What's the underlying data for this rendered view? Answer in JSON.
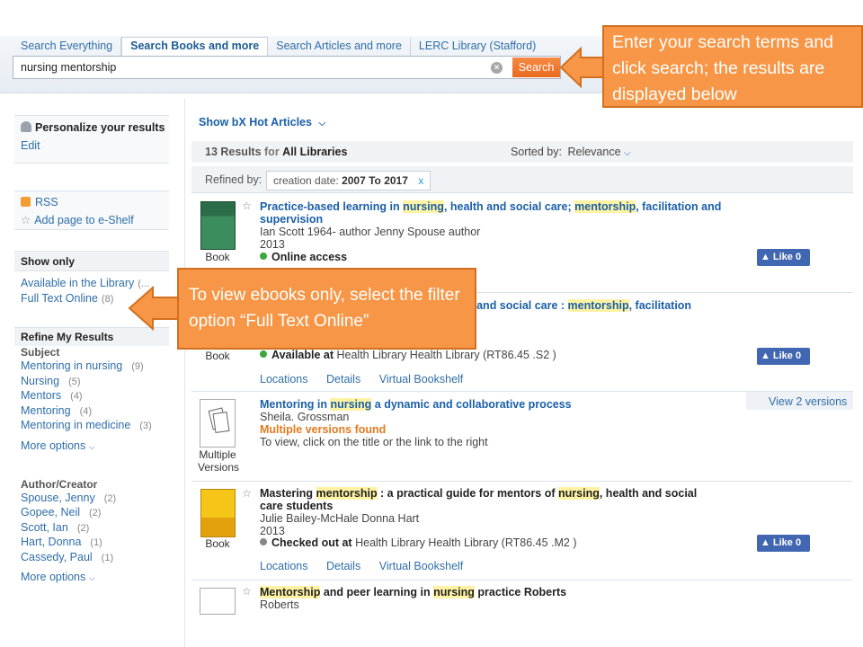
{
  "search": {
    "tabs": [
      "Search Everything",
      "Search Books and more",
      "Search Articles and more",
      "LERC Library (Stafford)"
    ],
    "active_tab": "Search Books and more",
    "query": "nursing mentorship",
    "clear_symbol": "×",
    "button_label": "Search"
  },
  "callouts": {
    "search": "Enter your search terms and click search; the results are displayed below",
    "filter": "To view ebooks only, select the filter option “Full Text Online”"
  },
  "sidebar": {
    "personalize_title": "Personalize your results",
    "edit_label": "Edit",
    "rss_label": "RSS",
    "eshelf_label": "Add page to e-Shelf",
    "show_only_title": "Show only",
    "show_only_items": [
      {
        "label": "Available in the Library",
        "count": "(..."
      },
      {
        "label": "Full Text Online",
        "count": "(8)"
      }
    ],
    "refine_title": "Refine My Results",
    "subject_title": "Subject",
    "subject_items": [
      {
        "label": "Mentoring in nursing",
        "count": "(9)"
      },
      {
        "label": "Nursing",
        "count": "(5)"
      },
      {
        "label": "Mentors",
        "count": "(4)"
      },
      {
        "label": "Mentoring",
        "count": "(4)"
      },
      {
        "label": "Mentoring in medicine",
        "count": "(3)"
      }
    ],
    "author_title": "Author/Creator",
    "author_items": [
      {
        "label": "Spouse, Jenny",
        "count": "(2)"
      },
      {
        "label": "Gopee, Neil",
        "count": "(2)"
      },
      {
        "label": "Scott, Ian",
        "count": "(2)"
      },
      {
        "label": "Hart, Donna",
        "count": "(1)"
      },
      {
        "label": "Cassedy, Paul",
        "count": "(1)"
      }
    ],
    "more_options": "More options"
  },
  "results_header": {
    "hot_articles": "Show bX Hot Articles",
    "count": "13 Results",
    "for_label": "for",
    "scope": "All Libraries",
    "sorted_label": "Sorted by:",
    "sort_value": "Relevance",
    "refined_label": "Refined by:",
    "refine_chip_label": "creation date:",
    "refine_chip_value": "2007 To 2017",
    "refine_chip_remove": "x"
  },
  "results": [
    {
      "type": "Book",
      "title_line1": [
        "Practice-based learning in ",
        "nursing",
        ", health and social care; ",
        "mentorship",
        ", facilitation and"
      ],
      "title_line2": "supervision",
      "authors": "Ian Scott 1964- author Jenny Spouse author",
      "year": "2013",
      "status": "Online access",
      "like": "Like 0"
    },
    {
      "type": "Book",
      "title_visible": [
        "n and social care : ",
        "mentorship",
        ", facilitation"
      ],
      "status_label": "Available at",
      "status_location": "Health Library  Health Library  (RT86.45 .S2 )",
      "actions": [
        "Locations",
        "Details",
        "Virtual Bookshelf"
      ],
      "like": "Like 0"
    },
    {
      "type": "Multiple Versions",
      "title": [
        "Mentoring in ",
        "nursing",
        " a dynamic and collaborative process"
      ],
      "authors": "Sheila. Grossman",
      "versions_found": "Multiple versions found",
      "note": "To view, click on the title or the link to the right",
      "versions_link": "View 2 versions"
    },
    {
      "type": "Book",
      "title_line1": [
        "Mastering ",
        "mentorship",
        " : a practical guide for mentors of ",
        "nursing",
        ", health and social"
      ],
      "title_line2": "care students",
      "authors": "Julie Bailey-McHale Donna Hart",
      "year": "2013",
      "status_label": "Checked out at",
      "status_location": "Health Library  Health Library  (RT86.45 .M2 )",
      "actions": [
        "Locations",
        "Details",
        "Virtual Bookshelf"
      ],
      "like": "Like 0"
    },
    {
      "title": [
        "Mentorship",
        " and peer learning in ",
        "nursing",
        " practice Roberts"
      ],
      "authors": "Roberts"
    }
  ],
  "colors": {
    "accent_orange": "#f79646",
    "link_blue": "#1a5fa8",
    "online_green": "#3aa83a",
    "checked_grey": "#888888",
    "facebook_blue": "#4267b2",
    "highlight": "#fff3a3"
  }
}
